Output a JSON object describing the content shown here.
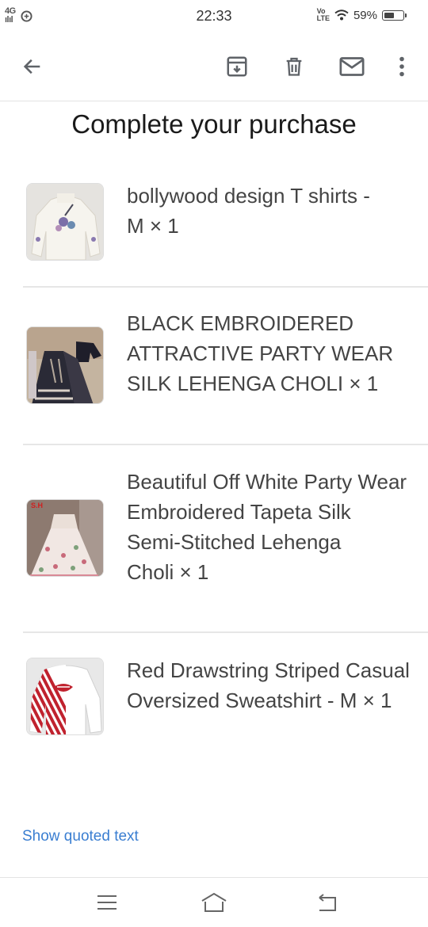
{
  "status_bar": {
    "network_badge_top": "4G",
    "network_badge_bottom": "ılıl",
    "time": "22:33",
    "volte_top": "Vo",
    "volte_bottom": "LTE",
    "battery_label": "59%",
    "battery_level": 0.59
  },
  "toolbar": {
    "back_icon": "arrow-left-icon",
    "archive_icon": "archive-icon",
    "delete_icon": "trash-icon",
    "mail_icon": "envelope-icon",
    "more_icon": "more-vert-icon"
  },
  "email": {
    "heading": "Complete your purchase",
    "products": [
      {
        "line1": "bollywood design T shirts -",
        "line2": "M × 1"
      },
      {
        "line1": "BLACK EMBROIDERED",
        "line2": "ATTRACTIVE PARTY WEAR",
        "line3": "SILK LEHENGA CHOLI × 1"
      },
      {
        "line1": "Beautiful Off White Party Wear",
        "line2": "Embroidered Tapeta Silk",
        "line3": "Semi-Stitched Lehenga",
        "line4": "Choli × 1",
        "thumb_tag": "S.H"
      },
      {
        "line1": "Red Drawstring Striped Casual",
        "line2": "Oversized Sweatshirt - M × 1"
      }
    ],
    "show_quoted_text": "Show quoted text"
  },
  "nav_bar": {
    "menu_icon": "menu-icon",
    "home_icon": "home-icon",
    "back_icon": "back-icon"
  },
  "colors": {
    "link": "#3a7ed1",
    "icon": "#5f6368",
    "divider": "#e6e6e6"
  }
}
